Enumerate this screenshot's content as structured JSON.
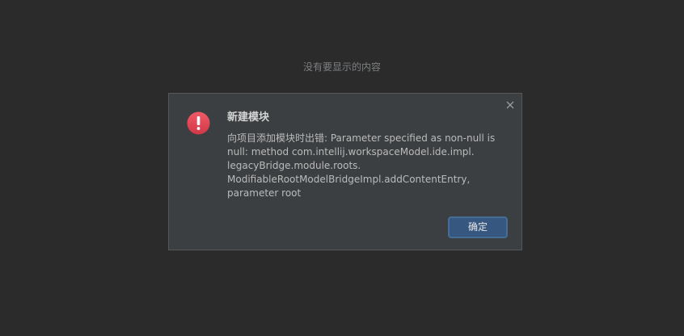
{
  "panel": {
    "empty_text": "没有要显示的内容"
  },
  "dialog": {
    "title": "新建模块",
    "message_lines": [
      "向项目添加模块时出错: Parameter specified as non-null is",
      "null: method com.intellij.workspaceModel.ide.impl.",
      "legacyBridge.module.roots.",
      "ModifiableRootModelBridgeImpl.addContentEntry,",
      "parameter root"
    ],
    "ok_label": "确定",
    "icon": "error-icon",
    "close_icon": "close-icon"
  },
  "colors": {
    "background": "#2b2b2b",
    "dialog_background": "#3c3f41",
    "error_red": "#e0404f",
    "button_blue": "#365880"
  }
}
